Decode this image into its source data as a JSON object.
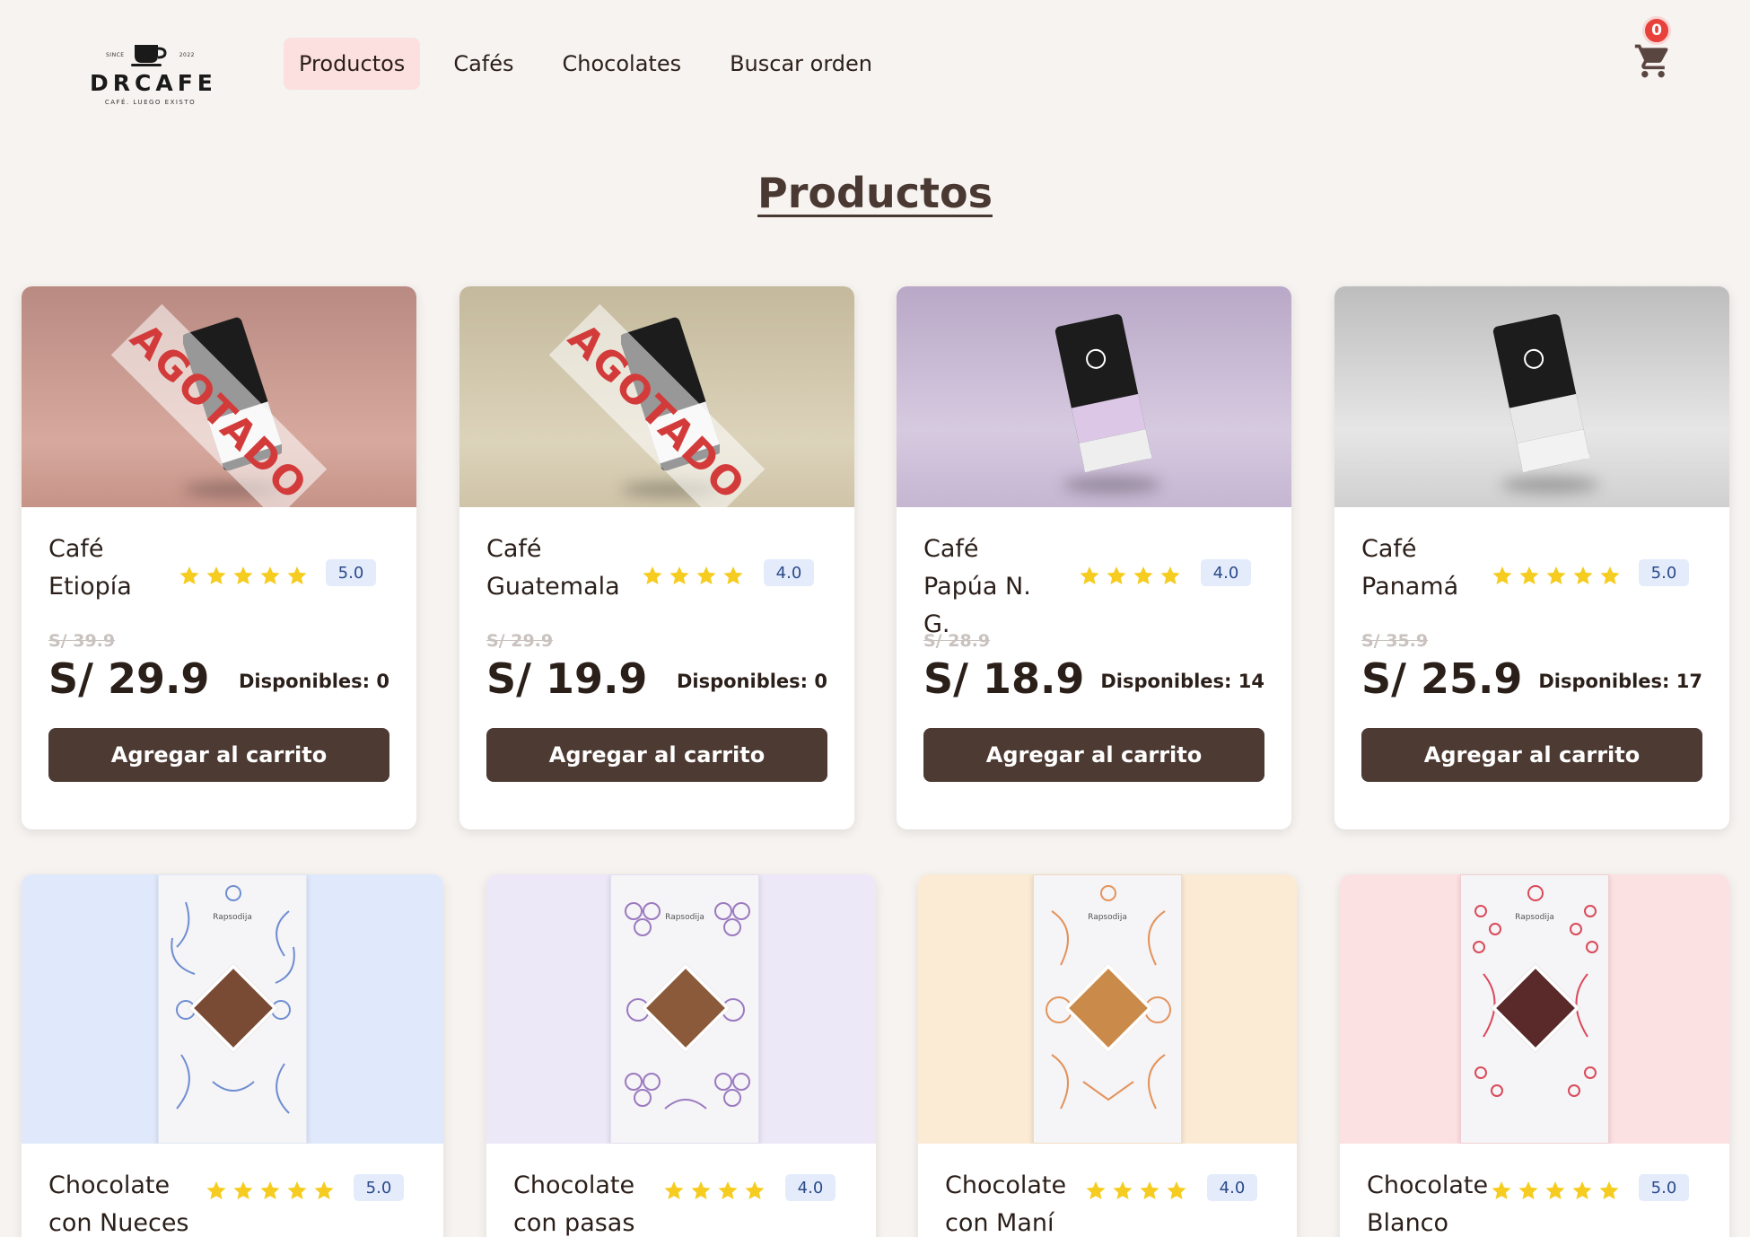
{
  "brand": {
    "since_left": "SINCE",
    "since_right": "2022",
    "name": "DRCAFE",
    "tagline": "CAFÉ. LUEGO EXISTO"
  },
  "nav": {
    "items": [
      "Productos",
      "Cafés",
      "Chocolates",
      "Buscar orden"
    ],
    "active": "Productos"
  },
  "cart": {
    "count": "0",
    "icon": "cart-icon"
  },
  "page_title": "Productos",
  "colors": {
    "background": "#f7f3f0",
    "button": "#4d3a33",
    "nav_active": "#fbe0df",
    "badge": "#e8403b",
    "star": "#f5cc1f",
    "rating_bg": "#e4ecfb",
    "stamp_text": "#d33b3b"
  },
  "products": [
    {
      "name": "Café Etiopía",
      "stars": 5,
      "rating": "5.0",
      "old_price": "S/ 39.9",
      "price": "S/ 29.9",
      "stock": "Disponibles: 0",
      "button": "Agregar al carrito",
      "badge": "AGOTADO",
      "image_bg": "#c8998f"
    },
    {
      "name": "Café Guatemala",
      "stars": 4,
      "rating": "4.0",
      "old_price": "S/ 29.9",
      "price": "S/ 19.9",
      "stock": "Disponibles: 0",
      "button": "Agregar al carrito",
      "badge": "AGOTADO",
      "image_bg": "#cfc6ad"
    },
    {
      "name": "Café Papúa N. G.",
      "stars": 4,
      "rating": "4.0",
      "old_price": "S/ 28.9",
      "price": "S/ 18.9",
      "stock": "Disponibles: 14",
      "button": "Agregar al carrito",
      "badge": "",
      "image_bg": "#cdbfd8"
    },
    {
      "name": "Café Panamá",
      "stars": 5,
      "rating": "5.0",
      "old_price": "S/ 35.9",
      "price": "S/ 25.9",
      "stock": "Disponibles: 17",
      "button": "Agregar al carrito",
      "badge": "",
      "image_bg": "#d9d9d9"
    },
    {
      "name": "Chocolate con Nueces",
      "stars": 5,
      "rating": "5.0",
      "image_bg": "#e0e9fb",
      "accent": "#6f8ed1",
      "label": "Rapsodija"
    },
    {
      "name": "Chocolate con pasas",
      "stars": 4,
      "rating": "4.0",
      "image_bg": "#ece8f8",
      "accent": "#9b7ac0",
      "label": "Rapsodija"
    },
    {
      "name": "Chocolate con Maní",
      "stars": 4,
      "rating": "4.0",
      "image_bg": "#fcebd4",
      "accent": "#e3935a",
      "label": "Rapsodija"
    },
    {
      "name": "Chocolate Blanco",
      "stars": 5,
      "rating": "5.0",
      "image_bg": "#fce1e3",
      "accent": "#d94a5a",
      "label": "Rapsodija"
    }
  ]
}
